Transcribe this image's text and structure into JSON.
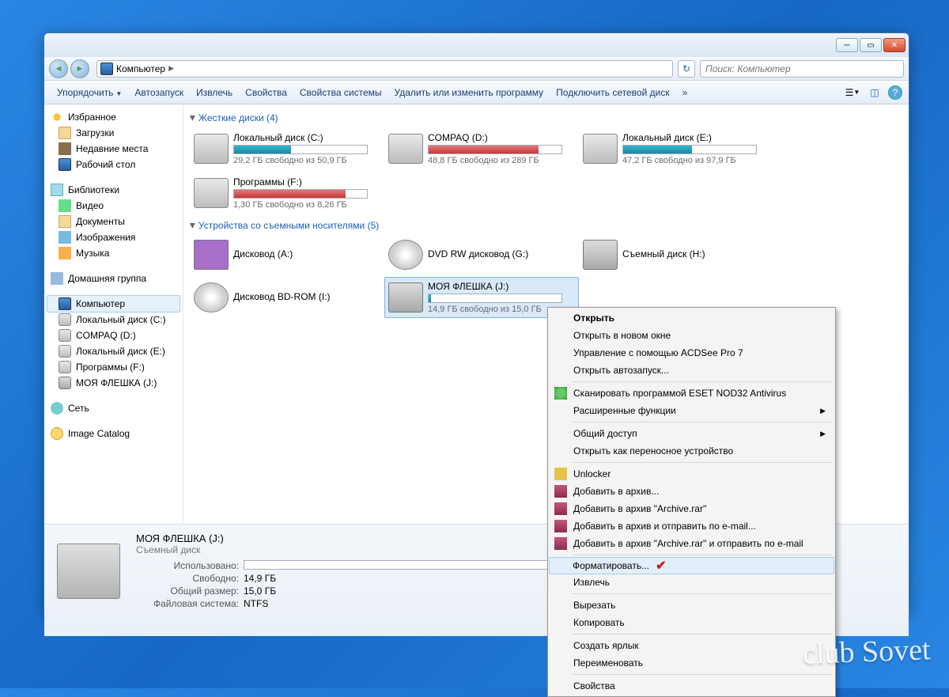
{
  "address": {
    "path": "Компьютер",
    "search_placeholder": "Поиск: Компьютер"
  },
  "toolbar": {
    "organize": "Упорядочить",
    "autoplay": "Автозапуск",
    "eject": "Извлечь",
    "properties": "Свойства",
    "sysprops": "Свойства системы",
    "uninstall": "Удалить или изменить программу",
    "mapdrive": "Подключить сетевой диск",
    "more": "»"
  },
  "sidebar": {
    "fav": {
      "head": "Избранное",
      "downloads": "Загрузки",
      "recent": "Недавние места",
      "desktop": "Рабочий стол"
    },
    "lib": {
      "head": "Библиотеки",
      "video": "Видео",
      "docs": "Документы",
      "pics": "Изображения",
      "music": "Музыка"
    },
    "homegroup": "Домашняя группа",
    "computer": {
      "head": "Компьютер",
      "c": "Локальный диск (C:)",
      "d": "COMPAQ (D:)",
      "e": "Локальный диск (E:)",
      "f": "Программы  (F:)",
      "j": "МОЯ ФЛЕШКА (J:)"
    },
    "network": "Сеть",
    "imagecat": "Image Catalog"
  },
  "cats": {
    "hdd": "Жесткие диски (4)",
    "removable": "Устройства со съемными носителями (5)"
  },
  "drives": {
    "c": {
      "name": "Локальный диск (C:)",
      "sub": "29,2 ГБ свободно из 50,9 ГБ",
      "pct": 43
    },
    "d": {
      "name": "COMPAQ (D:)",
      "sub": "48,8 ГБ свободно из 289 ГБ",
      "pct": 83
    },
    "e": {
      "name": "Локальный диск (E:)",
      "sub": "47,2 ГБ свободно из 97,9 ГБ",
      "pct": 52
    },
    "f": {
      "name": "Программы  (F:)",
      "sub": "1,30 ГБ свободно из 8,26 ГБ",
      "pct": 84
    },
    "a": {
      "name": "Дисковод (A:)"
    },
    "g": {
      "name": "DVD RW дисковод (G:)"
    },
    "h": {
      "name": "Съемный диск (H:)"
    },
    "i": {
      "name": "Дисковод BD-ROM (I:)"
    },
    "j": {
      "name": "МОЯ ФЛЕШКА (J:)",
      "sub": "14,9 ГБ свободно из 15,0 ГБ",
      "pct": 2
    }
  },
  "details": {
    "name": "МОЯ ФЛЕШКА (J:)",
    "type": "Съемный диск",
    "used_label": "Использовано:",
    "free_label": "Свободно:",
    "free_val": "14,9 ГБ",
    "total_label": "Общий размер:",
    "total_val": "15,0 ГБ",
    "fs_label": "Файловая система:",
    "fs_val": "NTFS"
  },
  "ctx": {
    "open": "Открыть",
    "open_new": "Открыть в новом окне",
    "acdsee": "Управление с помощью ACDSee Pro 7",
    "autoplay": "Открыть автозапуск...",
    "eset": "Сканировать программой ESET NOD32 Antivirus",
    "advanced": "Расширенные функции",
    "share": "Общий доступ",
    "portable": "Открыть как переносное устройство",
    "unlocker": "Unlocker",
    "arch1": "Добавить в архив...",
    "arch2": "Добавить в архив \"Archive.rar\"",
    "arch3": "Добавить в архив и отправить по e-mail...",
    "arch4": "Добавить в архив \"Archive.rar\" и отправить по e-mail",
    "format": "Форматировать...",
    "eject": "Извлечь",
    "cut": "Вырезать",
    "copy": "Копировать",
    "shortcut": "Создать ярлык",
    "rename": "Переименовать",
    "props": "Свойства"
  },
  "watermark": "club Sovet"
}
